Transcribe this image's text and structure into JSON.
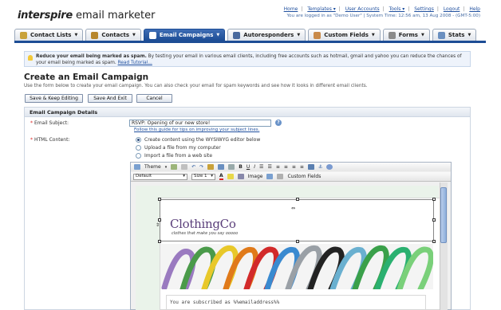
{
  "app": {
    "brand_bold": "interspire",
    "brand_rest": " email marketer"
  },
  "toplinks": [
    "Home",
    "Templates ▾",
    "User Accounts",
    "Tools ▾",
    "Settings",
    "Logout",
    "Help"
  ],
  "userline": "You are logged in as \"Demo User\" | System Time: 12:56 am, 13 Aug 2008 - (GMT-5:00)",
  "tabs": [
    {
      "label": "Contact Lists",
      "active": false,
      "color": "#c9a23a"
    },
    {
      "label": "Contacts",
      "active": false,
      "color": "#b7862c"
    },
    {
      "label": "Email Campaigns",
      "active": true,
      "color": "#ffffff"
    },
    {
      "label": "Autoresponders",
      "active": false,
      "color": "#4a6a9e"
    },
    {
      "label": "Custom Fields",
      "active": false,
      "color": "#c98a4a"
    },
    {
      "label": "Forms",
      "active": false,
      "color": "#8a8a8a"
    },
    {
      "label": "Stats",
      "active": false,
      "color": "#6a8fc0"
    }
  ],
  "info": {
    "bold": "Reduce your email being marked as spam.",
    "text": " By testing your email in various email clients, including free accounts such as hotmail, gmail and yahoo you can reduce the chances of your email being marked as spam. ",
    "link": "Read Tutorial..."
  },
  "page": {
    "title": "Create an Email Campaign",
    "desc": "Use the form below to create your email campaign. You can also check your email for spam keywords and see how it looks in different email clients."
  },
  "buttons": {
    "save_keep": "Save & Keep Editing",
    "save_exit": "Save And Exit",
    "cancel": "Cancel"
  },
  "details": {
    "header": "Email Campaign Details",
    "subject_label": "Email Subject:",
    "subject_value": "RSVP: Opening of our new store!",
    "subject_hint": "Follow this guide for tips on improving your subject lines.",
    "html_label": "HTML Content:",
    "options": [
      {
        "label": "Create content using the WYSIWYG editor below",
        "checked": true
      },
      {
        "label": "Upload a file from my computer",
        "checked": false
      },
      {
        "label": "Import a file from a web site",
        "checked": false
      }
    ]
  },
  "editor": {
    "theme_label": "Theme",
    "font_select": "Default",
    "size_select": "Size 1",
    "image_label": "Image",
    "custom_fields_label": "Custom Fields",
    "brand_logo": "ClothingCo",
    "tagline": "clothes that make you say ooooo",
    "subscribed_line": "You are subscribed as %%emailaddress%%"
  },
  "colors": {
    "accent": "#1d4d95",
    "link": "#1f4f9e",
    "required": "#dd2222"
  }
}
